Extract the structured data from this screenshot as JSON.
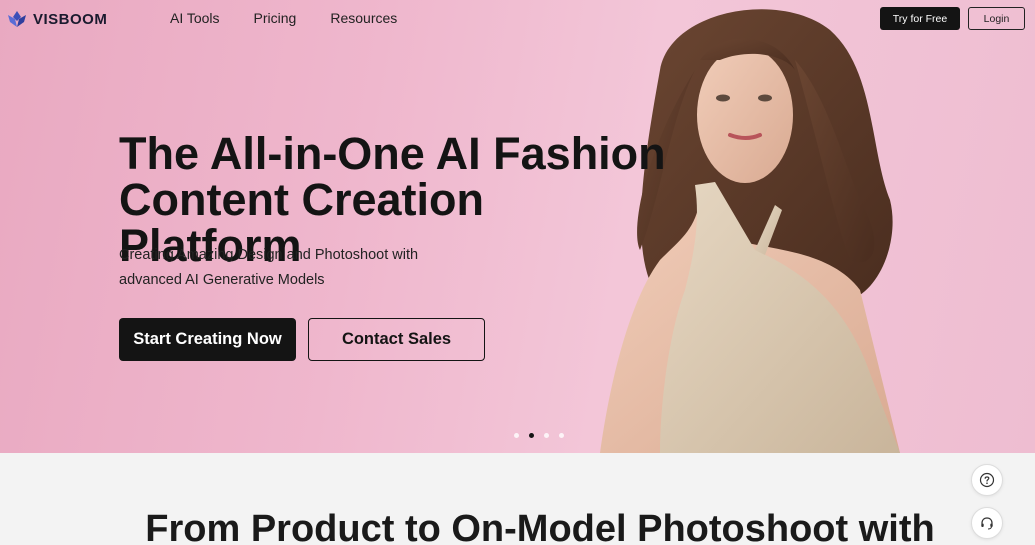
{
  "brand": {
    "name": "VISBOOM"
  },
  "nav": {
    "links": [
      "AI Tools",
      "Pricing",
      "Resources"
    ],
    "try_label": "Try for Free",
    "login_label": "Login"
  },
  "hero": {
    "title_line1": "The All-in-One AI Fashion",
    "title_line2": "Content Creation Platform",
    "subtitle_line1": "Creating Amazing Design and Photoshoot with",
    "subtitle_line2": "advanced AI Generative Models",
    "primary_cta": "Start Creating Now",
    "secondary_cta": "Contact Sales",
    "slide_count": 4,
    "active_slide": 2
  },
  "section": {
    "title": "From Product to On-Model Photoshoot with"
  },
  "floating": {
    "help_icon": "question-icon",
    "support_icon": "headset-icon"
  },
  "colors": {
    "hero_bg": "#efb7cd",
    "dark": "#141414",
    "page_bg": "#f3f3f3"
  }
}
